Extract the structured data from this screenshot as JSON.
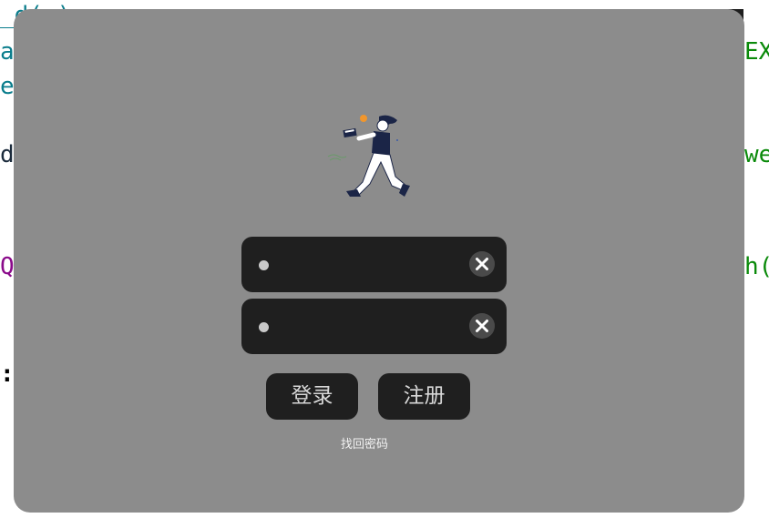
{
  "background_code": {
    "line1": "_d( )",
    "line2_left": "a",
    "line2_right": "EX+",
    "line3_left": "e",
    "line4_left": "d",
    "line4_right": "wel",
    "line5_left": "Q",
    "line5_right": "h(",
    "line6_left": ":"
  },
  "window": {
    "minimize_label": "–",
    "close_label": "✕"
  },
  "login": {
    "username_placeholder": "",
    "password_placeholder": "",
    "login_label": "登录",
    "register_label": "注册",
    "forgot_password_label": "找回密码"
  },
  "colors": {
    "dialog_bg": "#8c8c8c",
    "field_bg": "#1f1f1f",
    "accent_orange": "#f0962d",
    "figure_navy": "#1b2547"
  },
  "icons": {
    "clear": "close-circle-icon",
    "field_marker": "dot-icon",
    "illustration": "running-person-illustration"
  }
}
